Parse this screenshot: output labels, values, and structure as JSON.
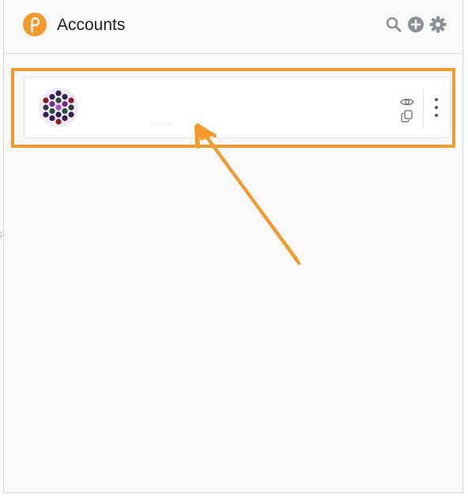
{
  "header": {
    "title": "Accounts",
    "logo_icon": "polkadot-logo-icon",
    "actions": [
      {
        "name": "search",
        "icon": "search-icon"
      },
      {
        "name": "add-account",
        "icon": "plus-circle-icon"
      },
      {
        "name": "settings",
        "icon": "gear-icon"
      }
    ]
  },
  "accounts": [
    {
      "name": "",
      "address_obscured": ". , . . . . .",
      "avatar_icon": "identicon-icon",
      "actions": [
        {
          "name": "show-address",
          "icon": "eye-icon"
        },
        {
          "name": "copy-address",
          "icon": "copy-icon"
        },
        {
          "name": "more-options",
          "icon": "vertical-dots-icon"
        }
      ]
    }
  ],
  "colors": {
    "brand_orange": "#f39a2d",
    "icon_gray": "#8c9199",
    "background": "#f9f9f9",
    "card": "#ffffff",
    "annotation": "#f39a2d"
  }
}
